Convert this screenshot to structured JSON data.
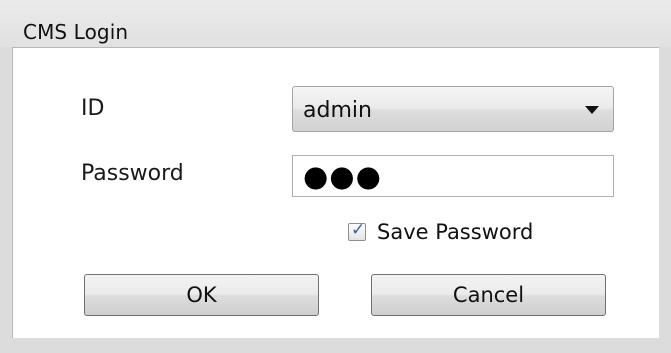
{
  "window": {
    "title": "CMS Login"
  },
  "form": {
    "id_label": "ID",
    "id_value": "admin",
    "password_label": "Password",
    "password_value": "●●●",
    "save_password_label": "Save Password",
    "save_password_checked": true
  },
  "buttons": {
    "ok": "OK",
    "cancel": "Cancel"
  },
  "icons": {
    "dropdown": "chevron-down-icon",
    "check": "check-icon"
  },
  "colors": {
    "check": "#3b5e9e",
    "title_bar": "#e6e5e5"
  }
}
